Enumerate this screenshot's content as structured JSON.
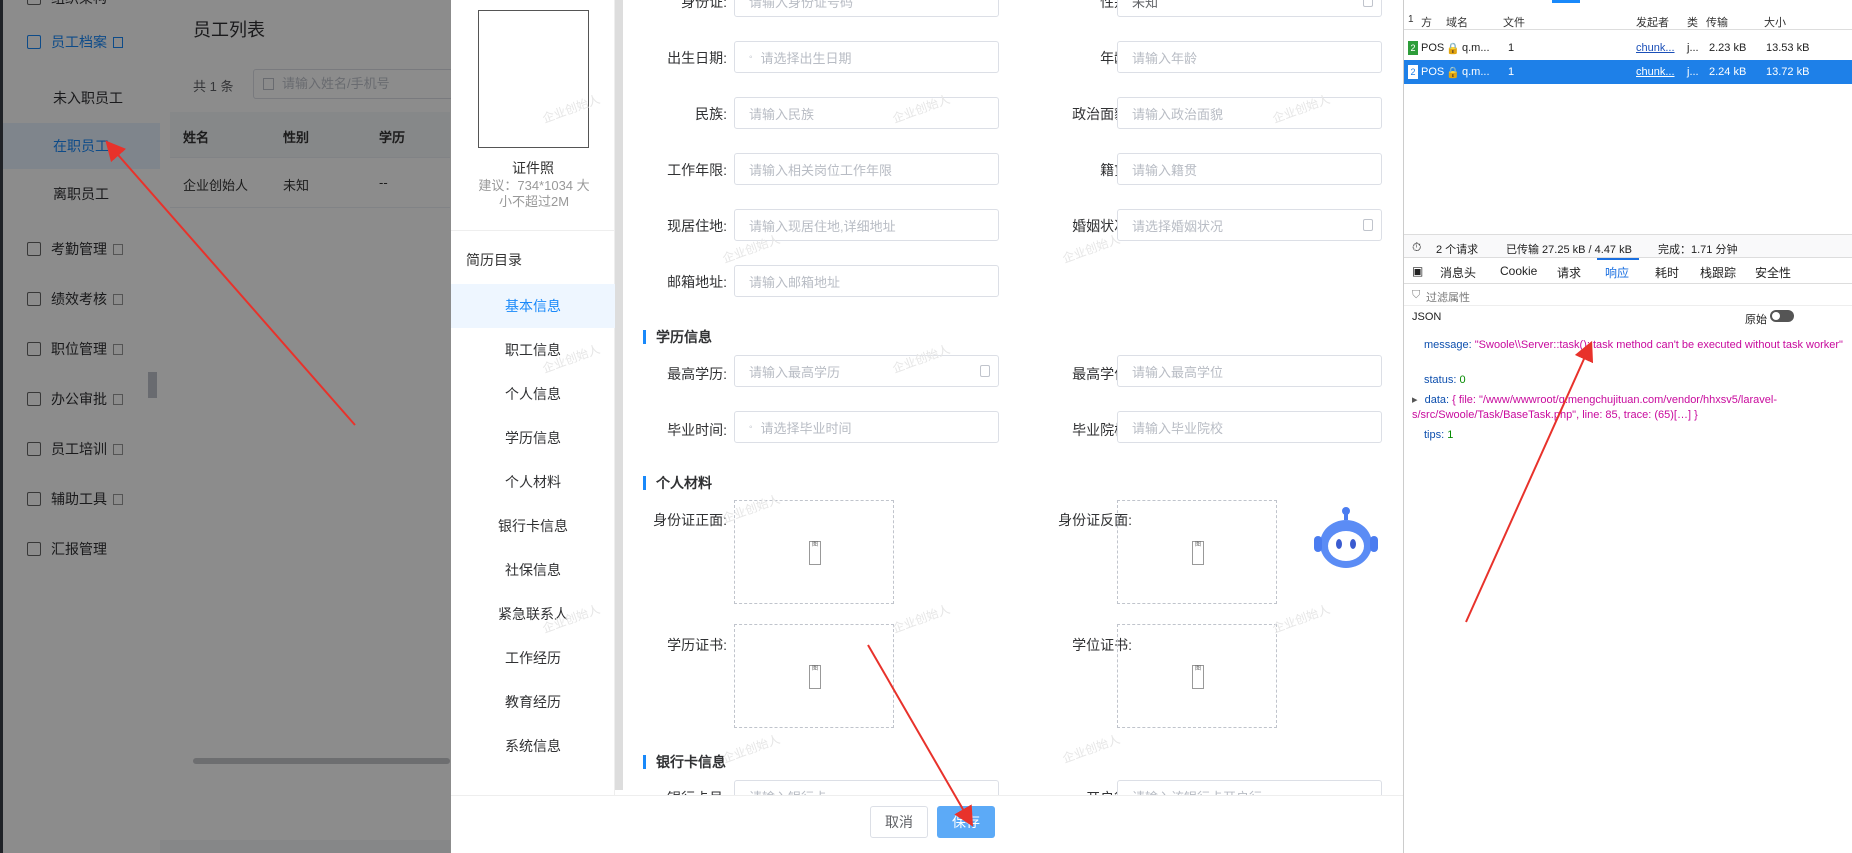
{
  "nav": {
    "top_partial": "组织架构",
    "archive": {
      "label": "员工档案",
      "children": [
        "未入职员工",
        "在职员工",
        "离职员工"
      ]
    },
    "items": [
      "考勤管理",
      "绩效考核",
      "职位管理",
      "办公审批",
      "员工培训",
      "辅助工具",
      "汇报管理"
    ]
  },
  "list": {
    "title": "员工列表",
    "count": "共 1 条",
    "search_placeholder": "请输入姓名/手机号",
    "columns": [
      "姓名",
      "性别",
      "学历"
    ],
    "rows": [
      [
        "企业创始人",
        "未知",
        "--"
      ]
    ]
  },
  "photo": {
    "title": "证件照",
    "hint": "建议：734*1034 大小不超过2M"
  },
  "toc": {
    "title": "简历目录",
    "items": [
      "基本信息",
      "职工信息",
      "个人信息",
      "学历信息",
      "个人材料",
      "银行卡信息",
      "社保信息",
      "紧急联系人",
      "工作经历",
      "教育经历",
      "系统信息"
    ]
  },
  "form": {
    "fields": [
      {
        "label": "身份证:",
        "placeholder": "请输入身份证号码"
      },
      {
        "label": "性别:",
        "placeholder": "未知"
      },
      {
        "label": "出生日期:",
        "placeholder": "请选择出生日期"
      },
      {
        "label": "年龄:",
        "placeholder": "请输入年龄"
      },
      {
        "label": "民族:",
        "placeholder": "请输入民族"
      },
      {
        "label": "政治面貌:",
        "placeholder": "请输入政治面貌"
      },
      {
        "label": "工作年限:",
        "placeholder": "请输入相关岗位工作年限"
      },
      {
        "label": "籍贯:",
        "placeholder": "请输入籍贯"
      },
      {
        "label": "现居住地:",
        "placeholder": "请输入现居住地,详细地址"
      },
      {
        "label": "婚姻状况:",
        "placeholder": "请选择婚姻状况"
      },
      {
        "label": "邮箱地址:",
        "placeholder": "请输入邮箱地址"
      }
    ],
    "edu_title": "学历信息",
    "edu_fields": [
      {
        "label": "最高学历:",
        "placeholder": "请输入最高学历"
      },
      {
        "label": "最高学位:",
        "placeholder": "请输入最高学位"
      },
      {
        "label": "毕业时间:",
        "placeholder": "请选择毕业时间"
      },
      {
        "label": "毕业院校:",
        "placeholder": "请输入毕业院校"
      }
    ],
    "material_title": "个人材料",
    "uploads": [
      "身份证正面:",
      "身份证反面:",
      "学历证书:",
      "学位证书:"
    ],
    "bank_title": "银行卡信息",
    "bank_fields": [
      {
        "label": "银行卡号:",
        "placeholder": "请输入银行卡"
      },
      {
        "label": "开户行:",
        "placeholder": "请输入该银行卡开户行"
      }
    ],
    "cancel": "取消",
    "save": "保存"
  },
  "watermark": "企业创始人",
  "devtools": {
    "columns": [
      "方",
      "域名",
      "文件",
      "发起者",
      "类",
      "传输",
      "大小"
    ],
    "requests": [
      {
        "status": "2",
        "method": "POS",
        "domain": "q.m...",
        "file": "1",
        "initiator": "chunk...",
        "type": "j...",
        "transferred": "2.23 kB",
        "size": "13.53 kB"
      },
      {
        "status": "2",
        "method": "POS",
        "domain": "q.m...",
        "file": "1",
        "initiator": "chunk...",
        "type": "j...",
        "transferred": "2.24 kB",
        "size": "13.72 kB"
      }
    ],
    "summary": {
      "count": "2 个请求",
      "transferred": "已传输 27.25 kB / 4.47 kB",
      "finish": "完成：1.71 分钟"
    },
    "tabs": [
      "消息头",
      "Cookie",
      "请求",
      "响应",
      "耗时",
      "栈跟踪",
      "安全性"
    ],
    "active_tab": "响应",
    "filter": "过滤属性",
    "json_label": "JSON",
    "raw_label": "原始",
    "json": {
      "message_key": "message:",
      "message_val": "\"Swoole\\\\Server::task(): task method can't be executed without task worker\"",
      "status_key": "status:",
      "status_val": "0",
      "data_key": "data:",
      "data_val": "{ file: \"/www/wwwroot/q.mengchujituan.com/vendor/hhxsv5/laravel-s/src/Swoole/Task/BaseTask.php\", line: 85, trace: (65)[…] }",
      "tips_key": "tips:",
      "tips_val": "1"
    }
  },
  "colors": {
    "accent": "#1989fa",
    "arrow": "#e8322b",
    "json_string": "#c80a9d",
    "json_number": "#058b00"
  }
}
